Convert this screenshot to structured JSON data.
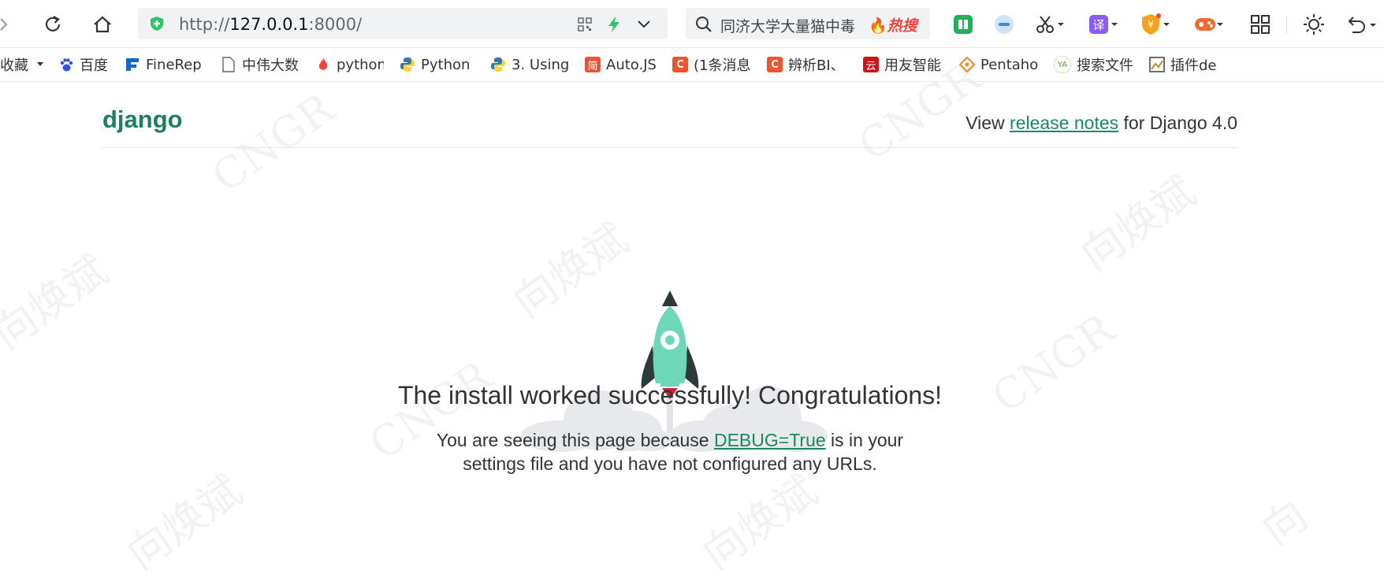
{
  "browser": {
    "url_prefix": "http://",
    "url_host": "127.0.0.1",
    "url_suffix": ":8000/",
    "search_query": "同济大学大量猫中毒",
    "search_hot_badge": "热搜"
  },
  "bookmarks": [
    {
      "label": "收藏",
      "icon": "star-folder-icon"
    },
    {
      "label": "百度",
      "icon": "baidu-paw-icon"
    },
    {
      "label": "FineRep",
      "icon": "finereport-icon"
    },
    {
      "label": "中伟大数",
      "icon": "page-icon"
    },
    {
      "label": "python",
      "icon": "flame-icon"
    },
    {
      "label": "Python",
      "icon": "python-icon"
    },
    {
      "label": "3. Using",
      "icon": "python-icon"
    },
    {
      "label": "Auto.JS",
      "icon": "jian-icon",
      "badge": "简"
    },
    {
      "label": "(1条消息",
      "icon": "csdn-icon",
      "badge": "C"
    },
    {
      "label": "辨析BI、",
      "icon": "csdn-icon",
      "badge": "C"
    },
    {
      "label": "用友智能",
      "icon": "yonyou-icon",
      "badge": "云"
    },
    {
      "label": "Pentaho",
      "icon": "pentaho-icon"
    },
    {
      "label": "搜索文件",
      "icon": "ya-icon",
      "badge": "YA"
    },
    {
      "label": "插件de",
      "icon": "plugin-image-icon"
    }
  ],
  "page": {
    "logo": "django",
    "release_prefix": "View ",
    "release_link": "release notes",
    "release_suffix": " for Django 4.0",
    "headline": "The install worked successfully! Congratulations!",
    "sub_prefix": "You are seeing this page because ",
    "sub_link": "DEBUG=True",
    "sub_suffix": " is in your settings file and you have not configured any URLs."
  },
  "colors": {
    "django_green": "#1e7f5c",
    "link_green": "#1b8a5a",
    "rocket_body": "#6dd7b8",
    "rocket_dark": "#2d3a3a",
    "cloud": "#e7e9ec",
    "flame": "#c8243d"
  }
}
